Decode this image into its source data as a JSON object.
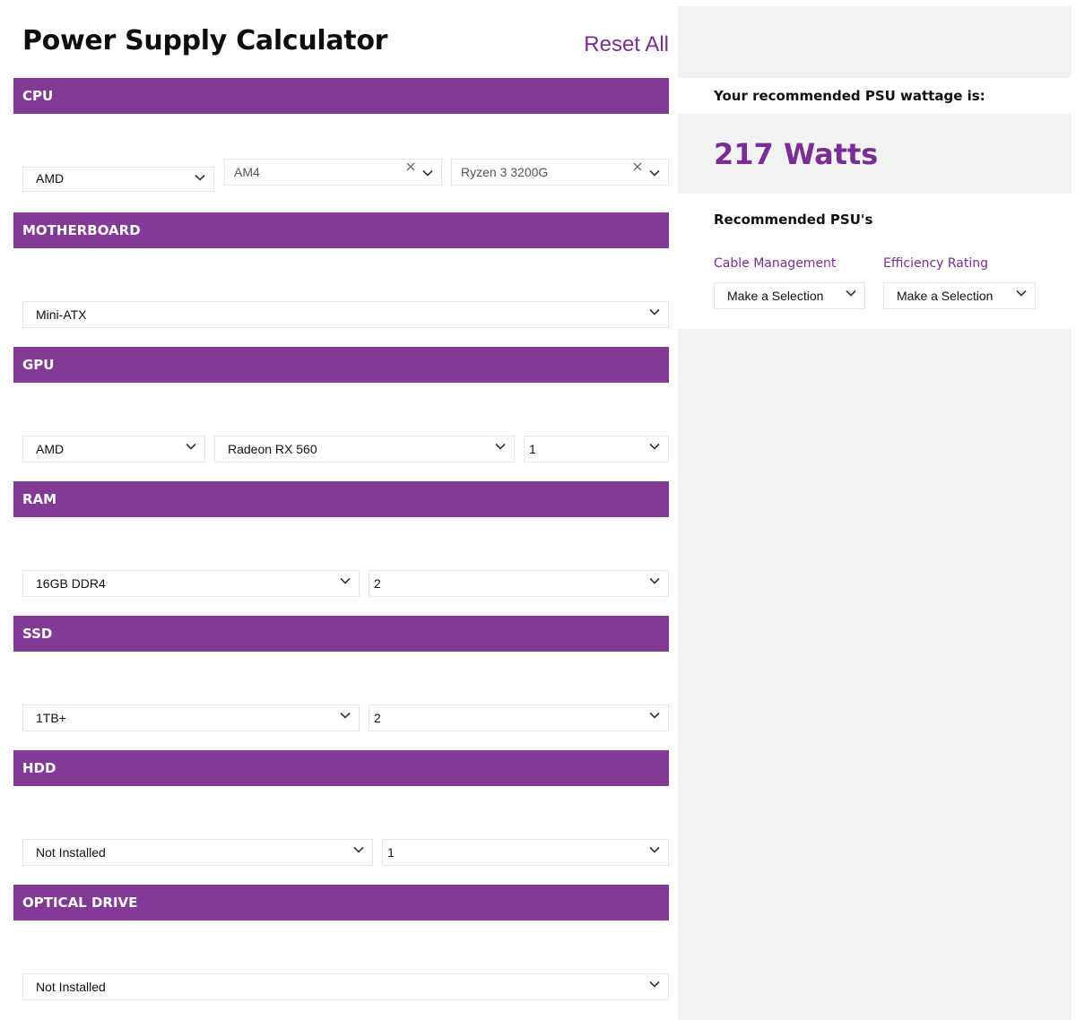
{
  "header": {
    "title": "Power Supply Calculator",
    "reset_label": "Reset All"
  },
  "sections": {
    "cpu": {
      "title": "CPU",
      "brand": "AMD",
      "socket": "AM4",
      "model": "Ryzen 3 3200G"
    },
    "motherboard": {
      "title": "MOTHERBOARD",
      "form_factor": "Mini-ATX"
    },
    "gpu": {
      "title": "GPU",
      "brand": "AMD",
      "model": "Radeon RX 560",
      "quantity": "1"
    },
    "ram": {
      "title": "RAM",
      "type": "16GB DDR4",
      "quantity": "2"
    },
    "ssd": {
      "title": "SSD",
      "size": "1TB+",
      "quantity": "2"
    },
    "hdd": {
      "title": "HDD",
      "type": "Not Installed",
      "quantity": "1"
    },
    "optical": {
      "title": "OPTICAL DRIVE",
      "type": "Not Installed"
    }
  },
  "result": {
    "label": "Your recommended PSU wattage is:",
    "watts": "217 Watts",
    "recommended_title": "Recommended PSU's",
    "cable_label": "Cable Management",
    "cable_value": "Make a Selection",
    "efficiency_label": "Efficiency Rating",
    "efficiency_value": "Make a Selection"
  },
  "colors": {
    "accent": "#833996",
    "link": "#7b2d96",
    "panel": "#f2f2f2"
  }
}
